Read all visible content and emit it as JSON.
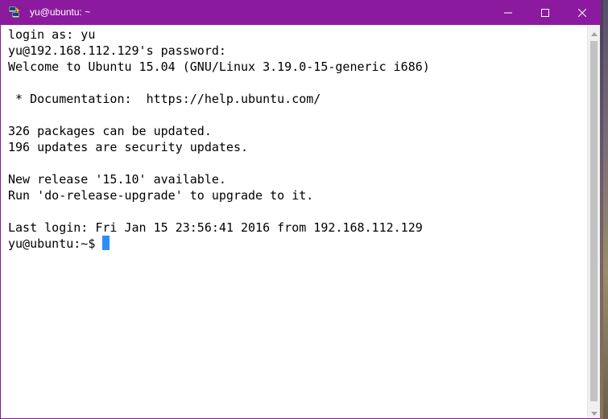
{
  "window": {
    "title": "yu@ubuntu: ~",
    "icon": "putty-icon",
    "accent_color": "#8c1a9f",
    "controls": {
      "minimize": "minimize-icon",
      "maximize": "maximize-icon",
      "close": "close-icon"
    }
  },
  "terminal": {
    "lines": [
      "login as: yu",
      "yu@192.168.112.129's password:",
      "Welcome to Ubuntu 15.04 (GNU/Linux 3.19.0-15-generic i686)",
      "",
      " * Documentation:  https://help.ubuntu.com/",
      "",
      "326 packages can be updated.",
      "196 updates are security updates.",
      "",
      "New release '15.10' available.",
      "Run 'do-release-upgrade' to upgrade to it.",
      "",
      "Last login: Fri Jan 15 23:56:41 2016 from 192.168.112.129"
    ],
    "prompt": "yu@ubuntu:~$ ",
    "cursor_color": "#2f8cff",
    "background": "#ffffff",
    "foreground": "#000000"
  }
}
